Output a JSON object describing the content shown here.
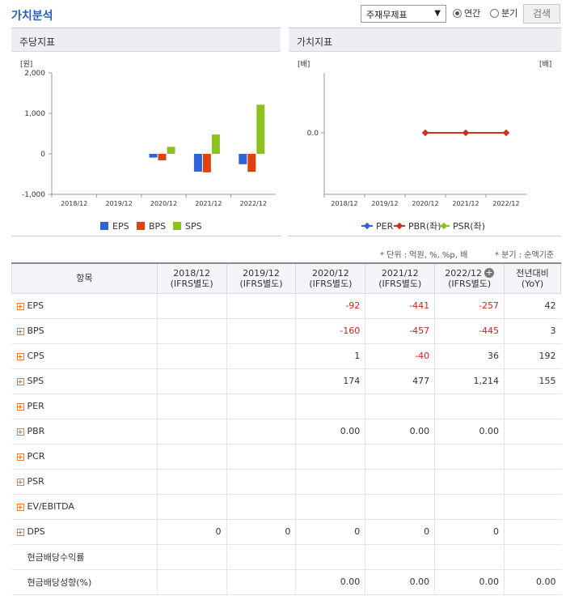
{
  "header": {
    "title": "가치분석",
    "select_value": "주재무제표",
    "radio_annual": "연간",
    "radio_quarter": "분기",
    "search_label": "검색"
  },
  "left_panel": {
    "title": "주당지표",
    "unit": "[원]"
  },
  "right_panel": {
    "title": "가치지표",
    "unit_left": "[배]",
    "unit_right": "[배]"
  },
  "chart_data": [
    {
      "type": "bar",
      "title": "주당지표",
      "ylabel": "[원]",
      "categories": [
        "2018/12",
        "2019/12",
        "2020/12",
        "2021/12",
        "2022/12"
      ],
      "series": [
        {
          "name": "EPS",
          "color": "#2f63d6",
          "values": [
            null,
            null,
            -92,
            -441,
            -257
          ]
        },
        {
          "name": "BPS",
          "color": "#e0420f",
          "values": [
            null,
            null,
            -160,
            -457,
            -445
          ]
        },
        {
          "name": "SPS",
          "color": "#8cc21e",
          "values": [
            null,
            null,
            174,
            477,
            1214
          ]
        }
      ],
      "ylim": [
        -1000,
        2000
      ],
      "yticks": [
        "2,000",
        "1,000",
        "0",
        "-1,000"
      ],
      "ytick_values": [
        2000,
        1000,
        0,
        -1000
      ],
      "legend": "bottom"
    },
    {
      "type": "line",
      "title": "가치지표",
      "ylabel": "[배]",
      "categories": [
        "2018/12",
        "2019/12",
        "2020/12",
        "2021/12",
        "2022/12"
      ],
      "series": [
        {
          "name": "PER",
          "color": "#2f63d6",
          "values": [
            null,
            null,
            null,
            null,
            null
          ]
        },
        {
          "name": "PBR(좌)",
          "color": "#d1301a",
          "values": [
            null,
            null,
            0.0,
            0.0,
            0.0
          ]
        },
        {
          "name": "PSR(좌)",
          "color": "#8cc21e",
          "values": [
            null,
            null,
            null,
            null,
            null
          ]
        }
      ],
      "yticks": [
        "0.0"
      ],
      "legend": "bottom"
    }
  ],
  "notes": {
    "unit": "* 단위 : 억원, %, %p, 배",
    "period": "* 분기 : 순액기준"
  },
  "table": {
    "headers": [
      {
        "line1": "항목",
        "line2": ""
      },
      {
        "line1": "2018/12",
        "line2": "(IFRS별도)"
      },
      {
        "line1": "2019/12",
        "line2": "(IFRS별도)"
      },
      {
        "line1": "2020/12",
        "line2": "(IFRS별도)"
      },
      {
        "line1": "2021/12",
        "line2": "(IFRS별도)"
      },
      {
        "line1": "2022/12",
        "line2": "(IFRS별도)"
      },
      {
        "line1": "전년대비",
        "line2": "(YoY)"
      }
    ],
    "rows": [
      {
        "label": "EPS",
        "expand": true,
        "cells": [
          "",
          "",
          "-92",
          "-441",
          "-257",
          "42"
        ]
      },
      {
        "label": "BPS",
        "expand": true,
        "cells": [
          "",
          "",
          "-160",
          "-457",
          "-445",
          "3"
        ]
      },
      {
        "label": "CPS",
        "expand": true,
        "cells": [
          "",
          "",
          "1",
          "-40",
          "36",
          "192"
        ]
      },
      {
        "label": "SPS",
        "expand": true,
        "cells": [
          "",
          "",
          "174",
          "477",
          "1,214",
          "155"
        ]
      },
      {
        "label": "PER",
        "expand": true,
        "cells": [
          "",
          "",
          "",
          "",
          "",
          ""
        ]
      },
      {
        "label": "PBR",
        "expand": true,
        "cells": [
          "",
          "",
          "0.00",
          "0.00",
          "0.00",
          ""
        ]
      },
      {
        "label": "PCR",
        "expand": true,
        "cells": [
          "",
          "",
          "",
          "",
          "",
          ""
        ]
      },
      {
        "label": "PSR",
        "expand": true,
        "cells": [
          "",
          "",
          "",
          "",
          "",
          ""
        ]
      },
      {
        "label": "EV/EBITDA",
        "expand": true,
        "cells": [
          "",
          "",
          "",
          "",
          "",
          ""
        ]
      },
      {
        "label": "DPS",
        "expand": true,
        "cells": [
          "0",
          "0",
          "0",
          "0",
          "0",
          ""
        ]
      },
      {
        "label": "현금배당수익률",
        "expand": false,
        "cells": [
          "",
          "",
          "",
          "",
          "",
          ""
        ]
      },
      {
        "label": "현금배당성향(%)",
        "expand": false,
        "cells": [
          "",
          "",
          "0.00",
          "0.00",
          "0.00",
          "0.00"
        ]
      }
    ]
  }
}
